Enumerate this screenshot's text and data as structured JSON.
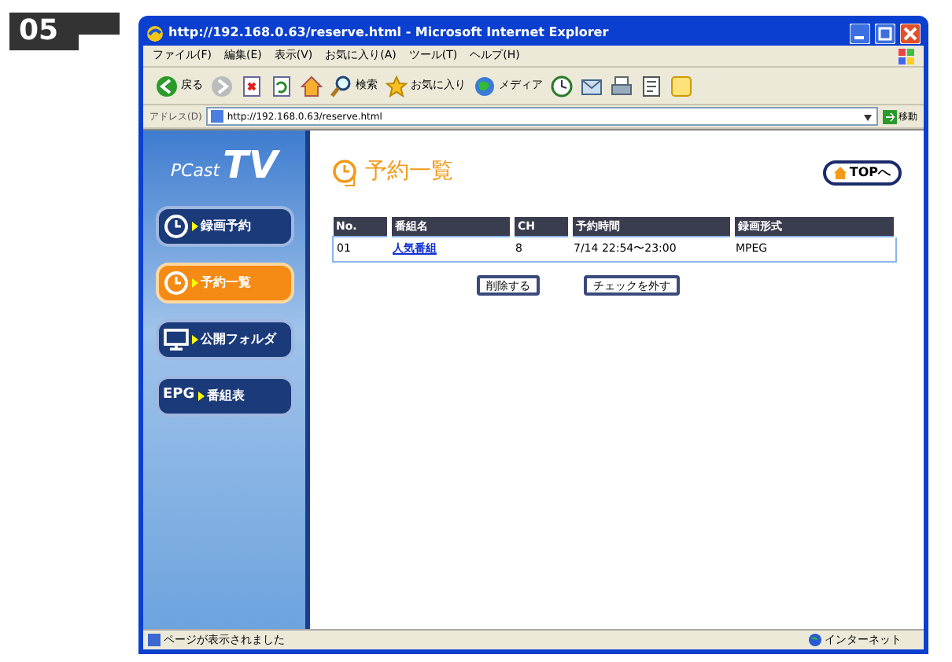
{
  "figure_label": "05",
  "window": {
    "title": "http://192.168.0.63/reserve.html - Microsoft Internet Explorer"
  },
  "menu": [
    "ファイル(F)",
    "編集(E)",
    "表示(V)",
    "お気に入り(A)",
    "ツール(T)",
    "ヘルプ(H)"
  ],
  "toolbar": [
    {
      "kind": "back",
      "label": "戻る"
    },
    {
      "kind": "forward"
    },
    {
      "kind": "stop"
    },
    {
      "kind": "refresh"
    },
    {
      "kind": "home"
    },
    {
      "kind": "search",
      "label": "検索"
    },
    {
      "kind": "favorites",
      "label": "お気に入り"
    },
    {
      "kind": "media",
      "label": "メディア"
    },
    {
      "kind": "history"
    },
    {
      "kind": "mail"
    },
    {
      "kind": "print"
    },
    {
      "kind": "edit"
    },
    {
      "kind": "messenger"
    }
  ],
  "address": {
    "label": "アドレス(D)",
    "value": "http://192.168.0.63/reserve.html",
    "go": "移動"
  },
  "sidebar": {
    "logo_small": "PCast",
    "logo": "TV",
    "items": [
      {
        "kind": "clock",
        "label": "録画予約",
        "selected": false
      },
      {
        "kind": "clock",
        "label": "予約一覧",
        "selected": true
      },
      {
        "kind": "folder",
        "label": "公開フォルダ",
        "selected": false
      },
      {
        "kind": "epg",
        "icon_text": "EPG",
        "label": "番組表",
        "selected": false
      }
    ]
  },
  "page": {
    "heading": "予約一覧",
    "top_button": "TOPへ",
    "table": {
      "columns": [
        "No.",
        "番組名",
        "CH",
        "予約時間",
        "録画形式"
      ],
      "rows": [
        [
          "01",
          "人気番組",
          "8",
          "7/14 22:54〜23:00",
          "MPEG"
        ]
      ]
    },
    "buttons": [
      "削除する",
      "チェックを外す"
    ]
  },
  "status_bar": {
    "text": "ページが表示されました",
    "zone": "インターネット"
  }
}
